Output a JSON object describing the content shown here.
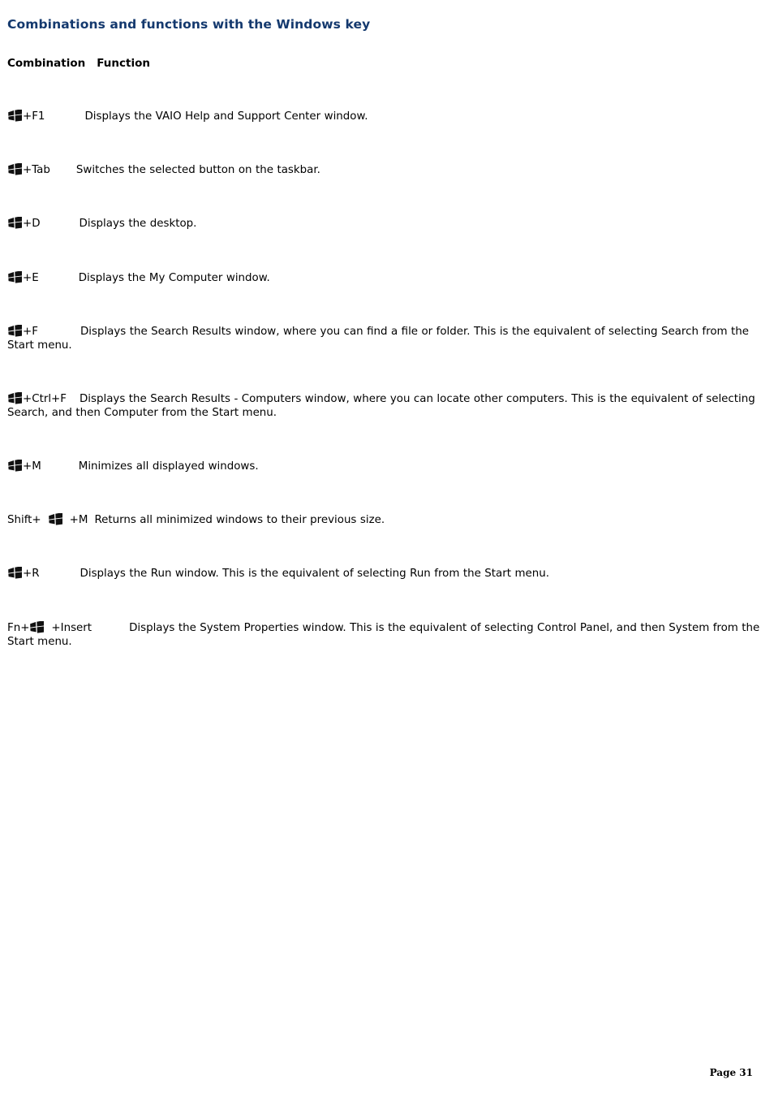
{
  "document": {
    "heading": "Combinations and functions with the Windows key",
    "page_label": "Page 31",
    "heading_color": "#14396e",
    "text_color": "#000000",
    "background_color": "#ffffff"
  },
  "table": {
    "headers": {
      "combination": "Combination",
      "function": "Function"
    },
    "icon_name": "windows-key-icon",
    "rows": [
      {
        "id": "win-f1",
        "prefix": "",
        "suffix": "+F1",
        "function": "Displays the VAIO Help and Support Center window."
      },
      {
        "id": "win-tab",
        "prefix": "",
        "suffix": "+Tab",
        "function": "Switches the selected button on the taskbar."
      },
      {
        "id": "win-d",
        "prefix": "",
        "suffix": "+D",
        "function": "Displays the desktop."
      },
      {
        "id": "win-e",
        "prefix": "",
        "suffix": "+E",
        "function": "Displays the My Computer window."
      },
      {
        "id": "win-f",
        "prefix": "",
        "suffix": "+F",
        "function": "Displays the Search Results window, where you can find a file or folder. This is the equivalent of selecting Search from the Start menu."
      },
      {
        "id": "win-ctrl-f",
        "prefix": "",
        "suffix": "+Ctrl+F",
        "function": "Displays the Search Results - Computers window, where you can locate other computers. This is the equivalent of selecting Search, and then Computer from the Start menu."
      },
      {
        "id": "win-m",
        "prefix": "",
        "suffix": "+M",
        "function": "Minimizes all displayed windows."
      },
      {
        "id": "shift-win-m",
        "prefix": "Shift+",
        "suffix": "+M",
        "function": "Returns all minimized windows to their previous size."
      },
      {
        "id": "win-r",
        "prefix": "",
        "suffix": "+R",
        "function": "Displays the Run window. This is the equivalent of selecting Run from the Start menu."
      },
      {
        "id": "fn-win-insert",
        "prefix": "Fn+",
        "suffix": "+Insert",
        "function": "Displays the System Properties window. This is the equivalent of selecting Control Panel, and then System from the Start menu."
      }
    ]
  }
}
